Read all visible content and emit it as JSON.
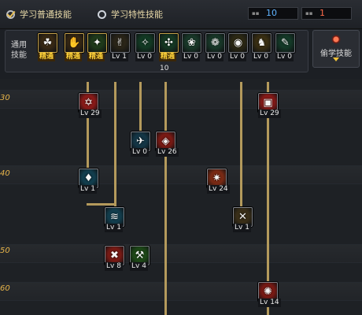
{
  "header": {
    "radio_normal": "学习普通技能",
    "radio_special": "学习特性技能",
    "points_left": "10",
    "points_right": "1"
  },
  "common": {
    "title": "通用技能",
    "skills": [
      {
        "name": "skill-icon-1",
        "level": "精通",
        "color": "#3a2a14"
      },
      {
        "name": "skill-icon-2",
        "level": "精通",
        "color": "#3a2a14"
      },
      {
        "name": "skill-icon-3",
        "level": "精通",
        "color": "#1f3a1a"
      },
      {
        "name": "skill-icon-4",
        "level": "Lv 1",
        "color": "#2a2518"
      },
      {
        "name": "skill-icon-5",
        "level": "Lv 0",
        "color": "#123a24"
      },
      {
        "name": "skill-icon-6",
        "level": "精通",
        "color": "#153a24"
      },
      {
        "name": "skill-icon-7",
        "level": "Lv 0",
        "color": "#193a2a"
      },
      {
        "name": "skill-icon-8",
        "level": "Lv 0",
        "color": "#193a2a"
      },
      {
        "name": "skill-icon-9",
        "level": "Lv 0",
        "color": "#2e2a14"
      },
      {
        "name": "skill-icon-10",
        "level": "Lv 0",
        "color": "#3a2f12"
      },
      {
        "name": "skill-icon-11",
        "level": "Lv 0",
        "color": "#143a28"
      }
    ],
    "marker": "10",
    "steal_label": "偷学技能"
  },
  "tiers": [
    "30",
    "40",
    "50",
    "60"
  ],
  "tree": [
    {
      "label": "Lv 29",
      "color": "#8a1a18"
    },
    {
      "label": "Lv 29",
      "color": "#8a1a18"
    },
    {
      "label": "Lv 0",
      "color": "#143646"
    },
    {
      "label": "Lv 26",
      "color": "#7a1a14"
    },
    {
      "label": "Lv 1",
      "color": "#123e4e"
    },
    {
      "label": "Lv 24",
      "color": "#7a2a14"
    },
    {
      "label": "Lv 1",
      "color": "#123e4e"
    },
    {
      "label": "Lv 1",
      "color": "#3a2f18"
    },
    {
      "label": "Lv 8",
      "color": "#7a1a14"
    },
    {
      "label": "Lv 4",
      "color": "#1e4a18"
    },
    {
      "label": "Lv 14",
      "color": "#7a1a14"
    }
  ]
}
